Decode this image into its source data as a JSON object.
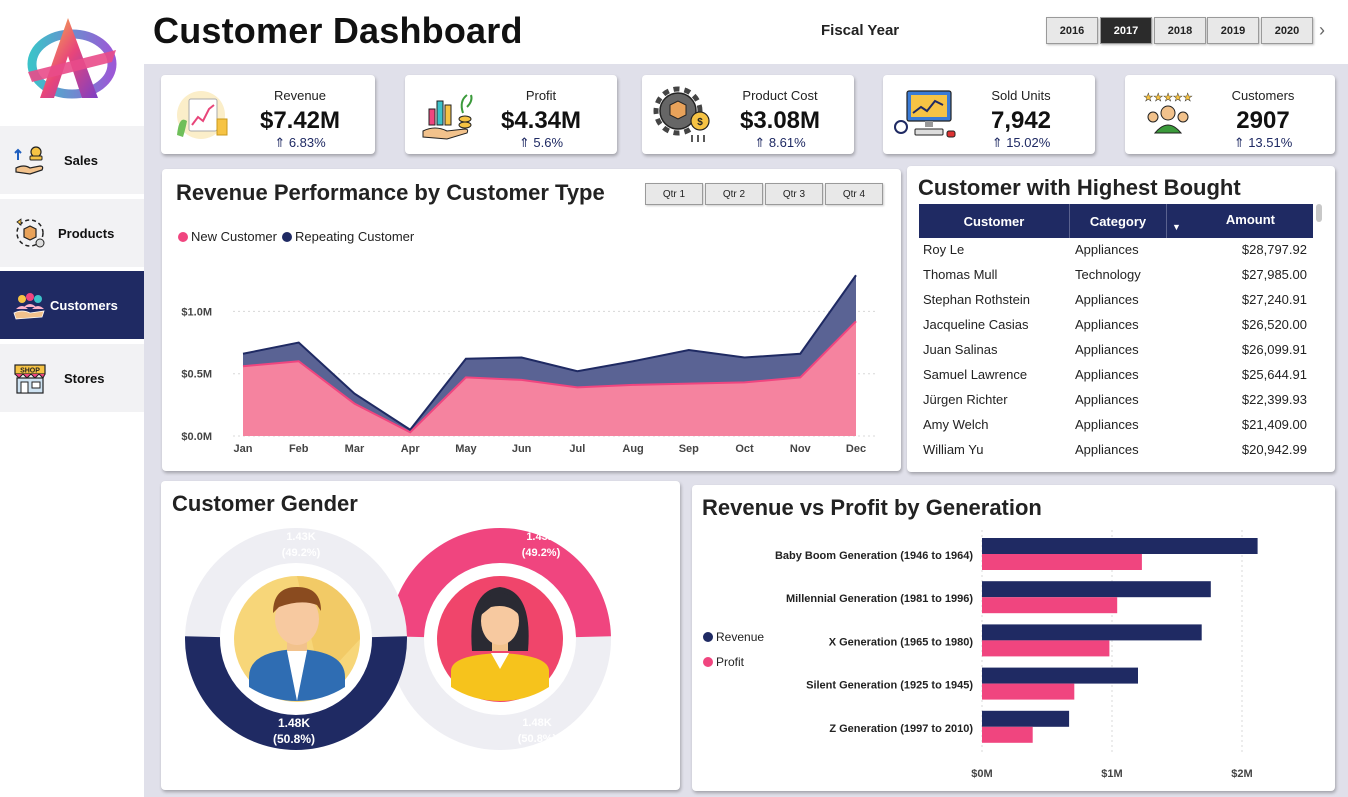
{
  "header": {
    "title": "Customer Dashboard",
    "fiscal_year_label": "Fiscal Year",
    "years": [
      "2016",
      "2017",
      "2018",
      "2019",
      "2020"
    ],
    "active_year": "2017",
    "next_icon": "chevron-right-icon"
  },
  "sidebar": {
    "items": [
      {
        "label": "Sales",
        "icon": "sales-icon",
        "active": false
      },
      {
        "label": "Products",
        "icon": "products-icon",
        "active": false
      },
      {
        "label": "Customers",
        "icon": "customers-icon",
        "active": true
      },
      {
        "label": "Stores",
        "icon": "shop-icon",
        "active": false
      }
    ]
  },
  "kpis": [
    {
      "label": "Revenue",
      "value": "$7.42M",
      "change": "⇑ 6.83%"
    },
    {
      "label": "Profit",
      "value": "$4.34M",
      "change": "⇑ 5.6%"
    },
    {
      "label": "Product Cost",
      "value": "$3.08M",
      "change": "⇑ 8.61%"
    },
    {
      "label": "Sold Units",
      "value": "7,942",
      "change": "⇑ 15.02%"
    },
    {
      "label": "Customers",
      "value": "2907",
      "change": "⇑ 13.51%"
    }
  ],
  "revenue_performance": {
    "title": "Revenue Performance by Customer Type",
    "quarters": [
      "Qtr 1",
      "Qtr 2",
      "Qtr 3",
      "Qtr 4"
    ],
    "legend": [
      {
        "name": "New Customer",
        "color": "#f0457f"
      },
      {
        "name": "Repeating Customer",
        "color": "#1f2a63"
      }
    ]
  },
  "top_customers": {
    "title": "Customer with Highest Bought",
    "columns": [
      "Customer",
      "Category",
      "Amount"
    ],
    "rows": [
      [
        "Roy Le",
        "Appliances",
        "$28,797.92"
      ],
      [
        "Thomas Mull",
        "Technology",
        "$27,985.00"
      ],
      [
        "Stephan Rothstein",
        "Appliances",
        "$27,240.91"
      ],
      [
        "Jacqueline Casias",
        "Appliances",
        "$26,520.00"
      ],
      [
        "Juan Salinas",
        "Appliances",
        "$26,099.91"
      ],
      [
        "Samuel Lawrence",
        "Appliances",
        "$25,644.91"
      ],
      [
        "Jürgen Richter",
        "Appliances",
        "$22,399.93"
      ],
      [
        "Amy Welch",
        "Appliances",
        "$21,409.00"
      ],
      [
        "William Yu",
        "Appliances",
        "$20,942.99"
      ]
    ]
  },
  "gender": {
    "title": "Customer Gender",
    "male": {
      "value": "1.48K",
      "pct": "(50.8%)",
      "share": 0.508,
      "other_value": "1.43K",
      "other_pct": "(49.2%)"
    },
    "female": {
      "value": "1.43K",
      "pct": "(49.2%)",
      "share": 0.492,
      "other_value": "1.48K",
      "other_pct": "(50.8%)"
    },
    "colors": {
      "male": "#1f2a63",
      "female": "#f0457f",
      "rest": "#eeeef3"
    }
  },
  "generation": {
    "title": "Revenue vs Profit by Generation",
    "legend": [
      {
        "name": "Revenue",
        "color": "#1f2a63"
      },
      {
        "name": "Profit",
        "color": "#f0457f"
      }
    ]
  },
  "chart_data": [
    {
      "type": "area",
      "title": "Revenue Performance by Customer Type",
      "categories": [
        "Jan",
        "Feb",
        "Mar",
        "Apr",
        "May",
        "Jun",
        "Jul",
        "Aug",
        "Sep",
        "Oct",
        "Nov",
        "Dec"
      ],
      "series": [
        {
          "name": "New Customer",
          "values": [
            0.56,
            0.6,
            0.26,
            0.03,
            0.47,
            0.45,
            0.39,
            0.41,
            0.42,
            0.43,
            0.47,
            0.92
          ]
        },
        {
          "name": "Repeating Customer",
          "values": [
            0.1,
            0.15,
            0.08,
            0.02,
            0.15,
            0.18,
            0.13,
            0.19,
            0.27,
            0.2,
            0.19,
            0.37
          ]
        }
      ],
      "stacked": true,
      "yticks": [
        "$0.0M",
        "$0.5M",
        "$1.0M"
      ],
      "ylim": [
        0,
        1.3
      ],
      "grid": true,
      "legend_position": "top-left"
    },
    {
      "type": "bar",
      "orientation": "horizontal",
      "title": "Revenue vs Profit by Generation",
      "categories": [
        "Baby Boom Generation (1946 to 1964)",
        "Millennial Generation (1981 to 1996)",
        "X Generation (1965 to 1980)",
        "Silent Generation (1925 to 1945)",
        "Z Generation (1997 to 2010)"
      ],
      "series": [
        {
          "name": "Revenue",
          "values": [
            2.12,
            1.76,
            1.69,
            1.2,
            0.67
          ]
        },
        {
          "name": "Profit",
          "values": [
            1.23,
            1.04,
            0.98,
            0.71,
            0.39
          ]
        }
      ],
      "xticks": [
        "$0M",
        "$1M",
        "$2M"
      ],
      "xlim": [
        0,
        2.4
      ],
      "legend_position": "left"
    },
    {
      "type": "pie",
      "title": "Customer Gender",
      "categories": [
        "Male",
        "Female"
      ],
      "values": [
        1480,
        1430
      ],
      "labels": [
        "1.48K (50.8%)",
        "1.43K (49.2%)"
      ]
    }
  ]
}
